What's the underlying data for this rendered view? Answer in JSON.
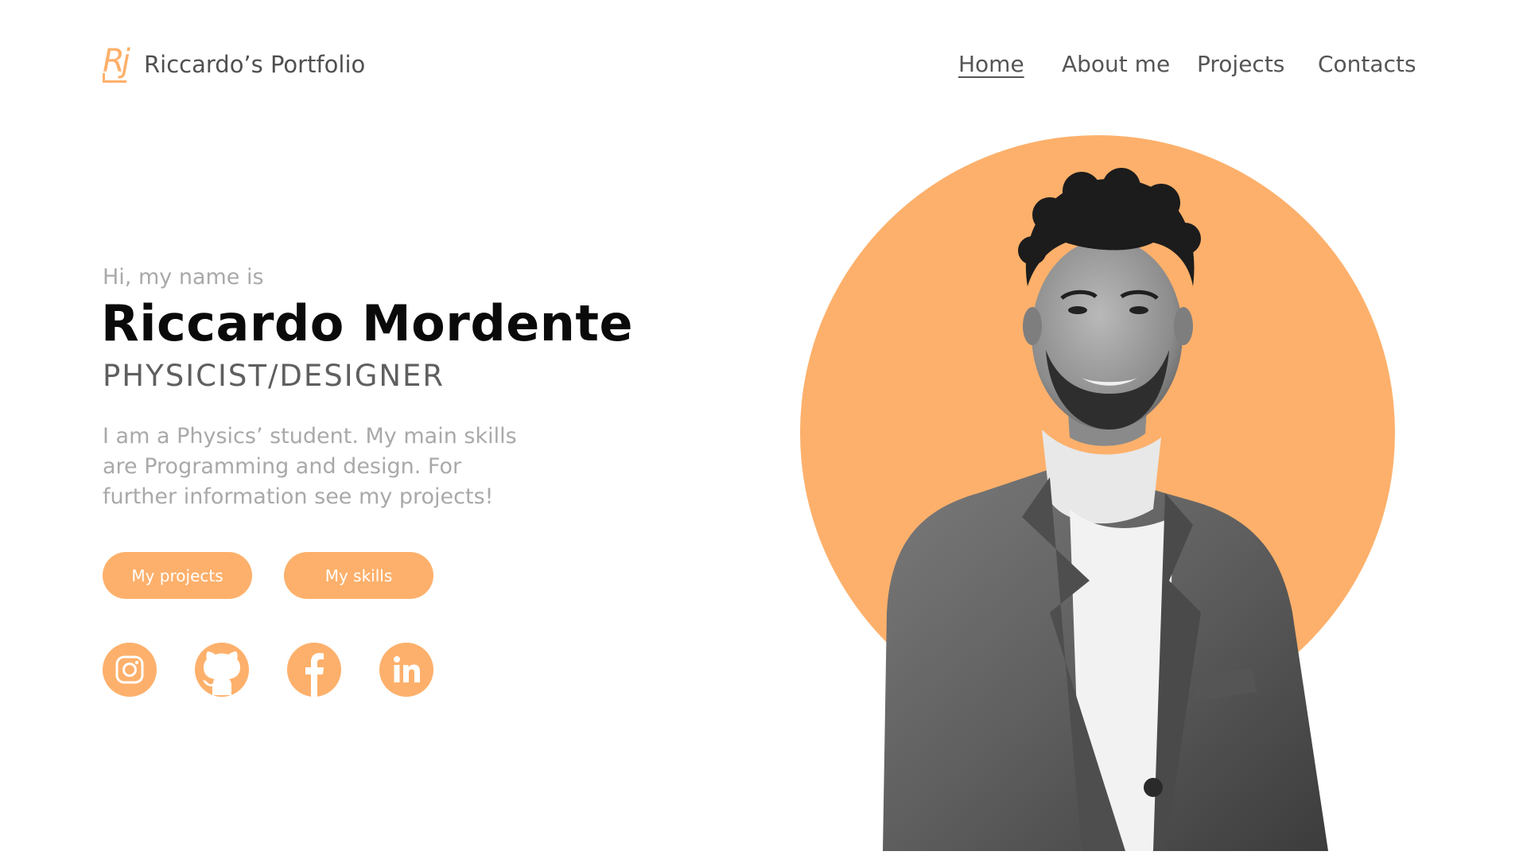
{
  "header": {
    "logo_letters": "Rj",
    "brand_name": "Riccardo’s Portfolio",
    "nav": [
      {
        "label": "Home",
        "active": true
      },
      {
        "label": "About me",
        "active": false
      },
      {
        "label": "Projects",
        "active": false
      },
      {
        "label": "Contacts",
        "active": false
      }
    ]
  },
  "hero": {
    "greeting": "Hi, my name is",
    "name": "Riccardo Mordente",
    "role": "PHYSICIST/DESIGNER",
    "bio": "I am a Physics’ student. My main skills are Programming and design. For further information see my projects!",
    "buttons": {
      "projects": "My projects",
      "skills": "My skills"
    },
    "social": [
      {
        "icon": "instagram-icon"
      },
      {
        "icon": "github-icon"
      },
      {
        "icon": "facebook-icon"
      },
      {
        "icon": "linkedin-icon"
      }
    ],
    "portrait": {
      "description_icon": "person-portrait-image"
    }
  },
  "colors": {
    "accent": "#fdb06b",
    "text_dark": "#0a0a0a",
    "text_muted": "#a9a9a9",
    "nav_text": "#555555"
  }
}
